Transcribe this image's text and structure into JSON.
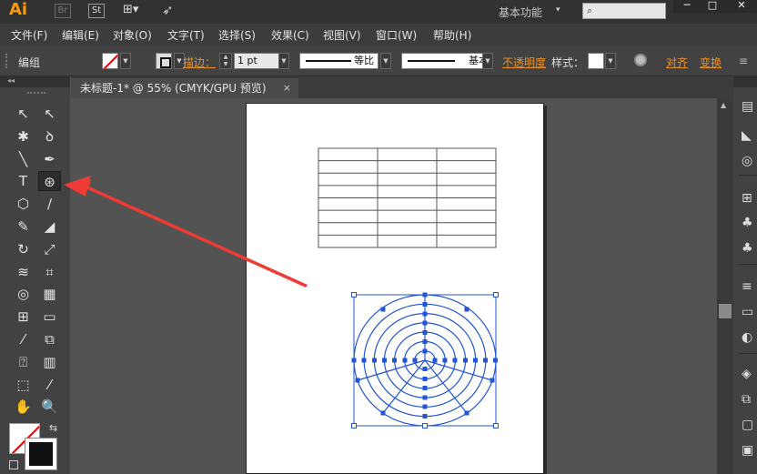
{
  "app": {
    "logo": "Ai",
    "bridge": "Br",
    "stock": "St",
    "workspace": "基本功能",
    "search_placeholder": "",
    "icons": [
      "layout-icon",
      "rocket-icon",
      "search-icon"
    ]
  },
  "window_controls": {
    "minimize": "─",
    "maximize": "□",
    "close": "✕"
  },
  "menu": {
    "items": [
      "文件(F)",
      "编辑(E)",
      "对象(O)",
      "文字(T)",
      "选择(S)",
      "效果(C)",
      "视图(V)",
      "窗口(W)",
      "帮助(H)"
    ]
  },
  "controlbar": {
    "group_label": "编组",
    "stroke_label": "描边：",
    "stroke_weight": "1 pt",
    "profile_label": "等比",
    "brush_label": "基本",
    "opacity_label": "不透明度",
    "style_label": "样式：",
    "align_label": "对齐",
    "transform_label": "变换"
  },
  "document": {
    "tab_title": "未标题-1* @ 55% (CMYK/GPU 预览)",
    "close_glyph": "×"
  },
  "toolbar": {
    "header_glyph": "◂◂",
    "tools": [
      {
        "name": "selection-tool",
        "glyph": "↖"
      },
      {
        "name": "direct-selection-tool",
        "glyph": "↖"
      },
      {
        "name": "magic-wand-tool",
        "glyph": "✱"
      },
      {
        "name": "lasso-tool",
        "glyph": "ꝺ"
      },
      {
        "name": "line-segment-tool",
        "glyph": "╲"
      },
      {
        "name": "pen-tool",
        "glyph": "✒"
      },
      {
        "name": "type-tool",
        "glyph": "T"
      },
      {
        "name": "polar-grid-tool",
        "glyph": "⊛"
      },
      {
        "name": "rectangle-tool",
        "glyph": "⬡"
      },
      {
        "name": "paintbrush-tool",
        "glyph": "∕"
      },
      {
        "name": "blob-brush-tool",
        "glyph": "✎"
      },
      {
        "name": "eraser-tool",
        "glyph": "◢"
      },
      {
        "name": "rotate-tool",
        "glyph": "↻"
      },
      {
        "name": "scale-tool",
        "glyph": "⤢"
      },
      {
        "name": "width-tool",
        "glyph": "≋"
      },
      {
        "name": "free-transform-tool",
        "glyph": "⌗"
      },
      {
        "name": "shape-builder-tool",
        "glyph": "◎"
      },
      {
        "name": "perspective-grid-tool",
        "glyph": "▦"
      },
      {
        "name": "mesh-tool",
        "glyph": "⊞"
      },
      {
        "name": "gradient-tool",
        "glyph": "▭"
      },
      {
        "name": "eyedropper-tool",
        "glyph": "⁄"
      },
      {
        "name": "blend-tool",
        "glyph": "⧉"
      },
      {
        "name": "symbol-sprayer-tool",
        "glyph": "⍰"
      },
      {
        "name": "column-graph-tool",
        "glyph": "▥"
      },
      {
        "name": "artboard-tool",
        "glyph": "⬚"
      },
      {
        "name": "slice-tool",
        "glyph": "⁄"
      },
      {
        "name": "hand-tool",
        "glyph": "✋"
      },
      {
        "name": "zoom-tool",
        "glyph": "🔍"
      }
    ],
    "swap_glyph": "⇆"
  },
  "right_panel": {
    "icons": [
      "color-icon",
      "color-guide-icon",
      "appearance-icon",
      "swatches-icon",
      "brushes-icon",
      "symbols-icon",
      "stroke-icon",
      "gradient-icon",
      "transparency-icon",
      "layers-icon",
      "links-icon"
    ]
  },
  "artwork": {
    "table": {
      "rows": 8,
      "cols": 3
    },
    "polar_grid": {
      "concentric_dividers": 6,
      "radial_dividers": 5,
      "color": "#2155d6"
    }
  },
  "colors": {
    "accent_orange": "#e8912a",
    "selection_blue": "#2155d6",
    "arrow_red": "#ef3b36"
  }
}
